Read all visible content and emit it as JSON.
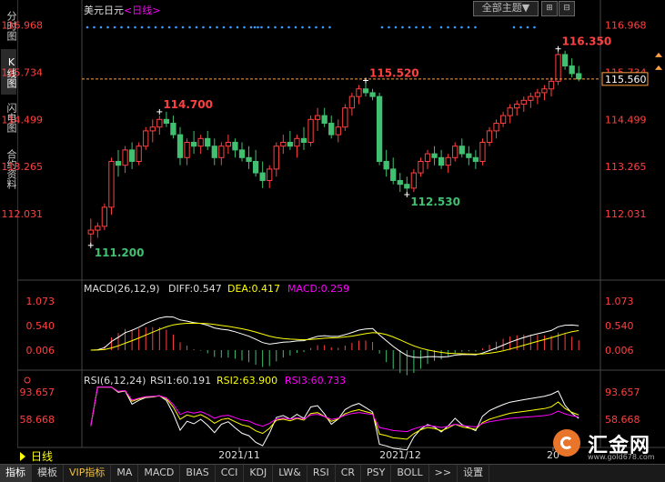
{
  "sidebar": {
    "tabs": [
      {
        "label": "分时图",
        "active": false
      },
      {
        "label": "K线图",
        "active": true
      },
      {
        "label": "闪电图",
        "active": false
      },
      {
        "label": "合约资料",
        "active": false
      }
    ]
  },
  "header": {
    "symbol": "美元日元",
    "period": "<日线>",
    "theme_btn": "全部主题▼",
    "btn1": "⊞",
    "btn2": "⊟"
  },
  "price_panel": {
    "y_labels": [
      "116.968",
      "115.734",
      "114.499",
      "113.265",
      "112.031"
    ],
    "current_price": "115.560",
    "high_label": "116.350",
    "annotations": [
      "114.700",
      "115.520",
      "112.530",
      "111.200"
    ],
    "colors": {
      "up": "#ff4040",
      "down": "#40c070",
      "current": "#ffa040"
    }
  },
  "macd_panel": {
    "title": "MACD(26,12,9)",
    "diff": "DIFF:0.547",
    "dea": "DEA:0.417",
    "macd": "MACD:0.259",
    "y_labels": [
      "1.073",
      "0.540",
      "0.006"
    ]
  },
  "rsi_panel": {
    "title": "RSI(6,12,24)",
    "rsi1": "RSI1:60.191",
    "rsi2": "RSI2:63.900",
    "rsi3": "RSI3:60.733",
    "y_labels": [
      "93.657",
      "58.668"
    ]
  },
  "x_labels": [
    "2021/11",
    "2021/12",
    "20"
  ],
  "period_strip": "日线",
  "bottom_tabs": [
    "指标",
    "模板",
    "VIP指标",
    "MA",
    "MACD",
    "BIAS",
    "CCI",
    "KDJ",
    "LW&",
    "RSI",
    "CR",
    "PSY",
    "BOLL",
    ">>",
    "设置"
  ],
  "logo": {
    "name": "汇金网",
    "url": "www.gold678.com"
  },
  "chart_data": {
    "type": "candlestick",
    "ylim": [
      110.6,
      117.2
    ],
    "candles": [
      [
        111.5,
        111.9,
        111.2,
        111.6
      ],
      [
        111.6,
        111.8,
        111.4,
        111.7
      ],
      [
        111.7,
        112.3,
        111.6,
        112.2
      ],
      [
        112.2,
        113.5,
        112.0,
        113.4
      ],
      [
        113.4,
        113.7,
        113.0,
        113.3
      ],
      [
        113.3,
        113.8,
        113.1,
        113.7
      ],
      [
        113.7,
        113.9,
        113.2,
        113.4
      ],
      [
        113.4,
        113.9,
        113.3,
        113.8
      ],
      [
        113.8,
        114.3,
        113.7,
        114.2
      ],
      [
        114.2,
        114.5,
        113.9,
        114.3
      ],
      [
        114.3,
        114.6,
        114.1,
        114.5
      ],
      [
        114.5,
        114.7,
        114.3,
        114.4
      ],
      [
        114.4,
        114.6,
        114.0,
        114.1
      ],
      [
        114.1,
        114.3,
        113.3,
        113.5
      ],
      [
        113.5,
        114.0,
        113.3,
        113.9
      ],
      [
        113.9,
        114.2,
        113.6,
        113.8
      ],
      [
        113.8,
        114.1,
        113.6,
        114.0
      ],
      [
        114.0,
        114.2,
        113.7,
        113.8
      ],
      [
        113.8,
        114.0,
        113.3,
        113.5
      ],
      [
        113.5,
        113.9,
        113.3,
        113.8
      ],
      [
        113.8,
        114.1,
        113.6,
        113.9
      ],
      [
        113.9,
        114.0,
        113.5,
        113.7
      ],
      [
        113.7,
        113.9,
        113.4,
        113.5
      ],
      [
        113.5,
        113.8,
        113.2,
        113.4
      ],
      [
        113.4,
        113.7,
        113.0,
        113.1
      ],
      [
        113.1,
        113.4,
        112.7,
        112.9
      ],
      [
        112.9,
        113.3,
        112.7,
        113.2
      ],
      [
        113.2,
        113.9,
        113.0,
        113.8
      ],
      [
        113.8,
        114.1,
        113.6,
        113.9
      ],
      [
        113.9,
        114.2,
        113.7,
        113.8
      ],
      [
        113.8,
        114.1,
        113.5,
        114.0
      ],
      [
        114.0,
        114.3,
        113.7,
        113.9
      ],
      [
        113.9,
        114.6,
        113.8,
        114.5
      ],
      [
        114.5,
        114.8,
        114.2,
        114.6
      ],
      [
        114.6,
        114.8,
        114.3,
        114.4
      ],
      [
        114.4,
        114.6,
        114.0,
        114.1
      ],
      [
        114.1,
        114.5,
        113.9,
        114.3
      ],
      [
        114.3,
        114.9,
        114.2,
        114.8
      ],
      [
        114.8,
        115.2,
        114.6,
        115.1
      ],
      [
        115.1,
        115.4,
        114.9,
        115.3
      ],
      [
        115.3,
        115.52,
        115.1,
        115.2
      ],
      [
        115.2,
        115.3,
        115.0,
        115.1
      ],
      [
        115.1,
        115.2,
        113.3,
        113.4
      ],
      [
        113.4,
        113.7,
        113.0,
        113.2
      ],
      [
        113.2,
        113.5,
        112.8,
        112.9
      ],
      [
        112.9,
        113.1,
        112.6,
        112.8
      ],
      [
        112.8,
        113.0,
        112.53,
        112.7
      ],
      [
        112.7,
        113.2,
        112.6,
        113.1
      ],
      [
        113.1,
        113.5,
        113.0,
        113.4
      ],
      [
        113.4,
        113.7,
        113.2,
        113.6
      ],
      [
        113.6,
        113.8,
        113.3,
        113.5
      ],
      [
        113.5,
        113.7,
        113.2,
        113.3
      ],
      [
        113.3,
        113.6,
        113.1,
        113.5
      ],
      [
        113.5,
        113.9,
        113.4,
        113.8
      ],
      [
        113.8,
        114.0,
        113.5,
        113.6
      ],
      [
        113.6,
        113.8,
        113.3,
        113.5
      ],
      [
        113.5,
        113.7,
        113.2,
        113.4
      ],
      [
        113.4,
        114.0,
        113.3,
        113.9
      ],
      [
        113.9,
        114.3,
        113.8,
        114.2
      ],
      [
        114.2,
        114.5,
        114.0,
        114.4
      ],
      [
        114.4,
        114.7,
        114.3,
        114.6
      ],
      [
        114.6,
        114.9,
        114.4,
        114.8
      ],
      [
        114.8,
        115.0,
        114.6,
        114.9
      ],
      [
        114.9,
        115.1,
        114.7,
        115.0
      ],
      [
        115.0,
        115.2,
        114.8,
        115.1
      ],
      [
        115.1,
        115.3,
        114.9,
        115.2
      ],
      [
        115.2,
        115.4,
        115.0,
        115.3
      ],
      [
        115.3,
        115.6,
        115.1,
        115.5
      ],
      [
        115.5,
        116.35,
        115.4,
        116.2
      ],
      [
        116.2,
        116.3,
        115.8,
        115.9
      ],
      [
        115.9,
        116.1,
        115.6,
        115.7
      ],
      [
        115.7,
        115.9,
        115.5,
        115.56
      ]
    ]
  }
}
